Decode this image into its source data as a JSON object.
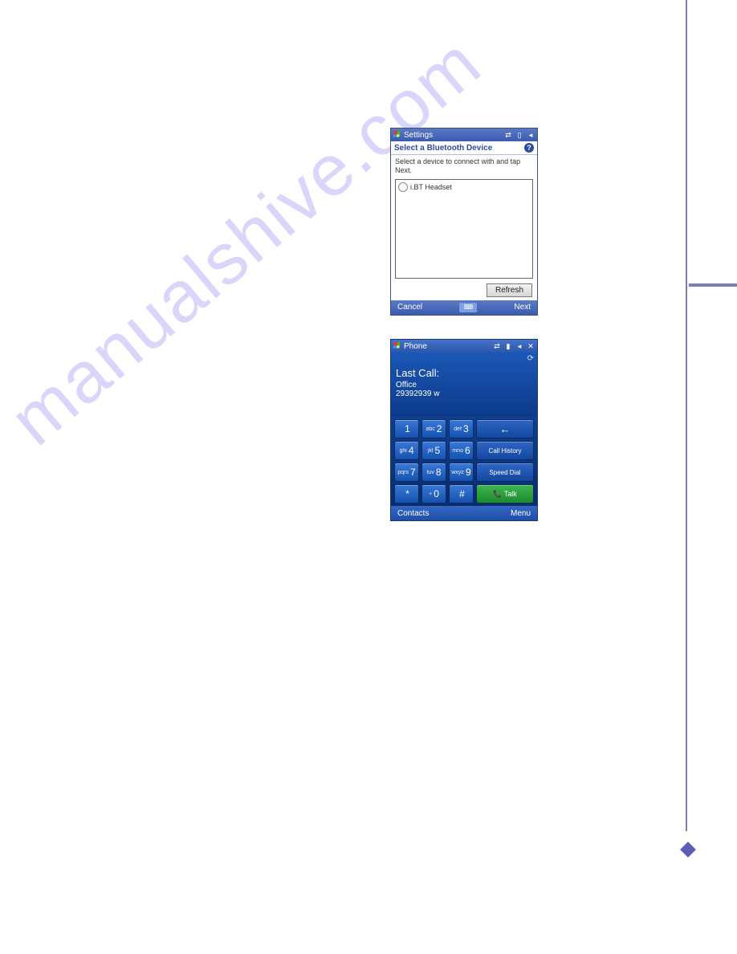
{
  "watermark": "manualshive.com",
  "shot1": {
    "title": "Settings",
    "subhead": "Select a Bluetooth Device",
    "help": "?",
    "instruction": "Select a device to connect with and tap Next.",
    "device": "i.BT Headset",
    "refresh": "Refresh",
    "cancel": "Cancel",
    "next": "Next",
    "sip": "⌨"
  },
  "shot2": {
    "title": "Phone",
    "lastCallLabel": "Last Call:",
    "lastCallName": "Office",
    "lastCallNumber": "29392939  w",
    "keys": {
      "r1": [
        {
          "sub": "",
          "dig": "1"
        },
        {
          "sub": "abc",
          "dig": "2"
        },
        {
          "sub": "def",
          "dig": "3"
        }
      ],
      "r2": [
        {
          "sub": "ghi",
          "dig": "4"
        },
        {
          "sub": "jkl",
          "dig": "5"
        },
        {
          "sub": "mno",
          "dig": "6"
        }
      ],
      "r3": [
        {
          "sub": "pqrs",
          "dig": "7"
        },
        {
          "sub": "tuv",
          "dig": "8"
        },
        {
          "sub": "wxyz",
          "dig": "9"
        }
      ],
      "r4": [
        {
          "sub": "",
          "dig": "*"
        },
        {
          "sub": "+",
          "dig": "0"
        },
        {
          "sub": "",
          "dig": "#"
        }
      ],
      "backspace": "←",
      "callHistory": "Call History",
      "speedDial": "Speed Dial",
      "talk": "📞 Talk"
    },
    "menuLeft": "Contacts",
    "menuRight": "Menu",
    "closeIcon": "✕"
  }
}
